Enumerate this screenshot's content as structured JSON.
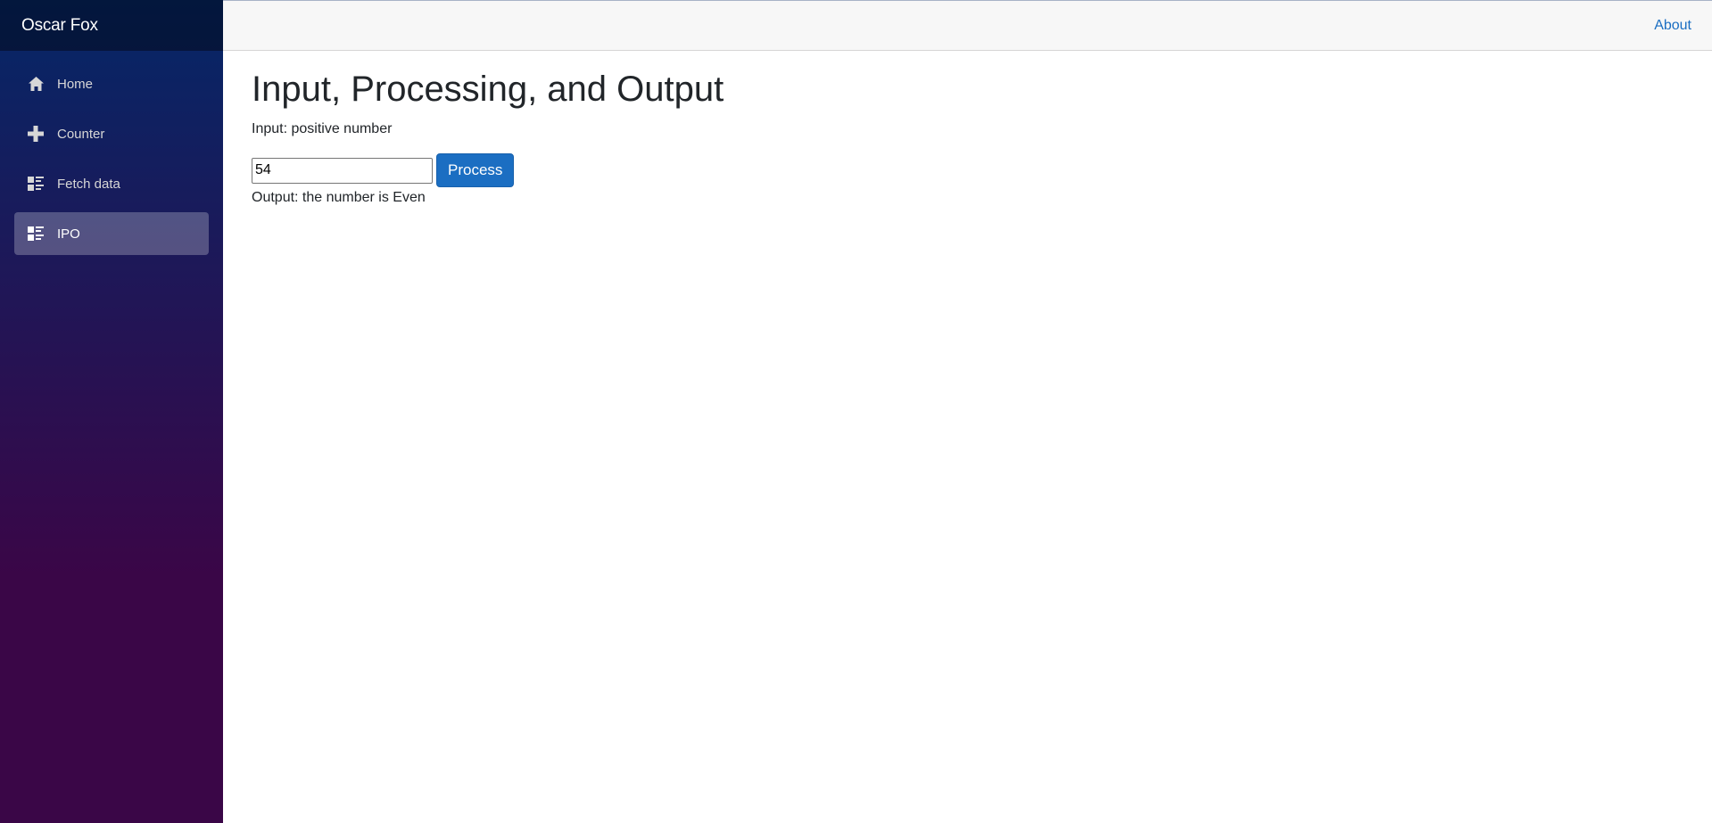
{
  "sidebar": {
    "brand": "Oscar Fox",
    "items": [
      {
        "label": "Home",
        "icon": "home-icon",
        "active": false
      },
      {
        "label": "Counter",
        "icon": "plus-icon",
        "active": false
      },
      {
        "label": "Fetch data",
        "icon": "list-rich-icon",
        "active": false
      },
      {
        "label": "IPO",
        "icon": "list-rich-icon",
        "active": true
      }
    ]
  },
  "header": {
    "about_label": "About"
  },
  "main": {
    "title": "Input, Processing, and Output",
    "input_label": "Input: positive number",
    "number_value": "54",
    "process_label": "Process",
    "output_text": "Output: the number is Even"
  },
  "colors": {
    "accent": "#1b6ec2",
    "sidebar_top": "#052767",
    "sidebar_bottom": "#3a0647"
  }
}
